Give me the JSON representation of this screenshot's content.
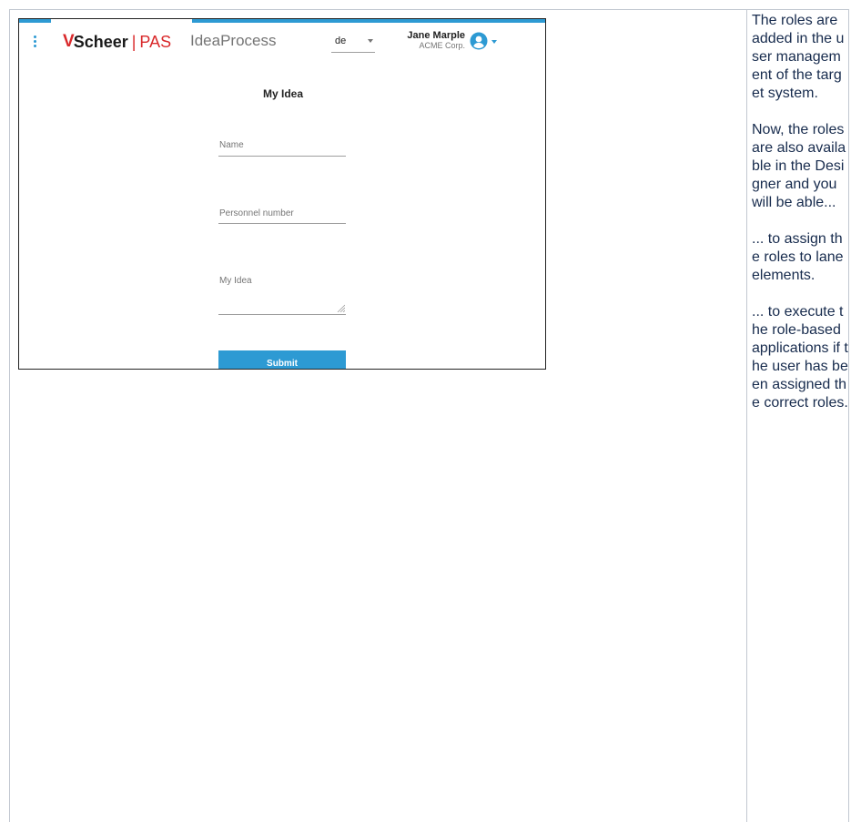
{
  "app": {
    "brand_mark": "V",
    "brand_name": "Scheer",
    "brand_sep": "|",
    "brand_product": "PAS",
    "app_name": "IdeaProcess"
  },
  "header": {
    "language_value": "de",
    "user_name": "Jane Marple",
    "user_org": "ACME Corp."
  },
  "form": {
    "title": "My Idea",
    "name_label": "Name",
    "personnel_label": "Personnel number",
    "idea_label": "My Idea",
    "submit_label": "Submit"
  },
  "notes": {
    "p1": "The roles are added in the user management of the target system.",
    "p2": "Now, the roles are also available in the Designer and you will be able...",
    "p3": "... to assign the roles to lane elements.",
    "p4": "... to execute the role-based applications if the user has been assigned the correct roles."
  },
  "colors": {
    "accent": "#2d9ad3",
    "brand_red": "#d9292b",
    "border": "#c1c7d0"
  },
  "icons": {
    "menu": "kebab-menu-icon",
    "avatar": "user-avatar-icon",
    "dropdown": "chevron-down-icon",
    "resize": "resize-grip-icon"
  }
}
